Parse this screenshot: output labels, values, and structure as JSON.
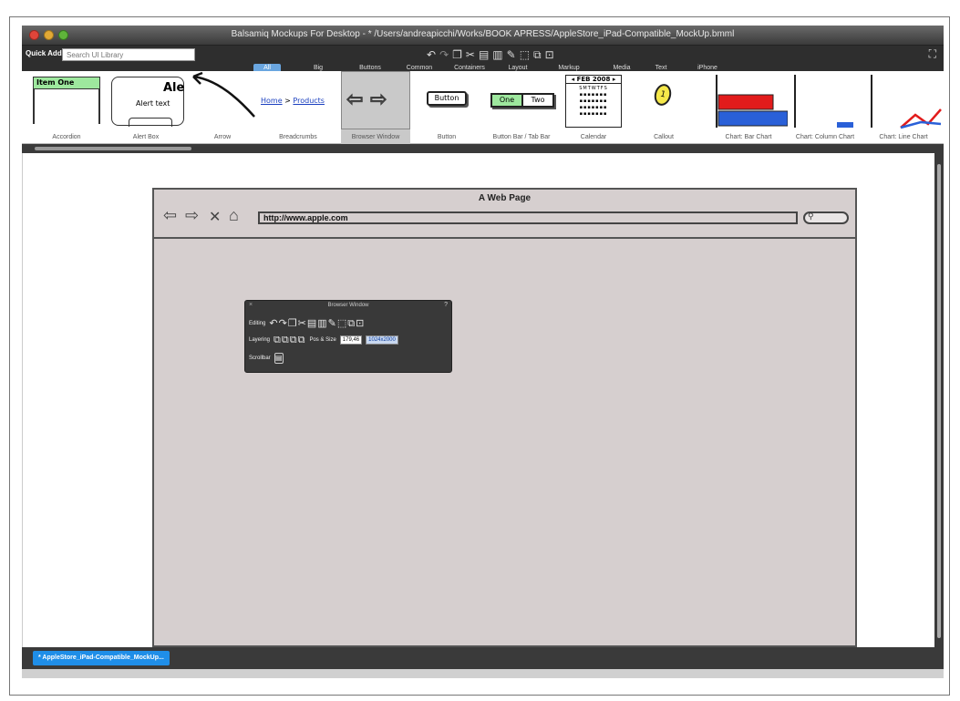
{
  "window": {
    "title": "Balsamiq Mockups For Desktop - * /Users/andreapicchi/Works/BOOK APRESS/AppleStore_iPad-Compatible_MockUp.bmml"
  },
  "toolbar": {
    "quick_add_label": "Quick Add:",
    "search_placeholder": "Search UI Library",
    "edit_icons": [
      "undo-icon",
      "redo-icon",
      "duplicate-icon",
      "cut-icon",
      "copy-icon",
      "paste-icon",
      "edit-icon",
      "group-icon",
      "ungroup-icon",
      "lock-icon"
    ]
  },
  "tabs": [
    {
      "label": "All",
      "active": true
    },
    {
      "label": "Big",
      "active": false
    },
    {
      "label": "Buttons",
      "active": false
    },
    {
      "label": "Common",
      "active": false
    },
    {
      "label": "Containers",
      "active": false
    },
    {
      "label": "Layout",
      "active": false
    },
    {
      "label": "Markup",
      "active": false
    },
    {
      "label": "Media",
      "active": false
    },
    {
      "label": "Text",
      "active": false
    },
    {
      "label": "iPhone",
      "active": false
    }
  ],
  "library": {
    "items": [
      {
        "label": "Accordion",
        "preview": "Item One"
      },
      {
        "label": "Alert Box",
        "preview_title": "Ale",
        "preview_text": "Alert text"
      },
      {
        "label": "Arrow"
      },
      {
        "label": "Breadcrumbs",
        "preview_home": "Home",
        "preview_sep": ">",
        "preview_products": "Products"
      },
      {
        "label": "Browser Window"
      },
      {
        "label": "Button",
        "preview": "Button"
      },
      {
        "label": "Button Bar / Tab Bar",
        "preview_one": "One",
        "preview_two": "Two"
      },
      {
        "label": "Calendar",
        "preview": "FEB 2008"
      },
      {
        "label": "Callout",
        "preview": "1"
      },
      {
        "label": "Chart: Bar Chart"
      },
      {
        "label": "Chart: Column Chart"
      },
      {
        "label": "Chart: Line Chart"
      }
    ]
  },
  "mockup": {
    "browser_title": "A Web Page",
    "url": "http://www.apple.com"
  },
  "inspector": {
    "title": "Browser Window",
    "editing_label": "Editing",
    "layering_label": "Layering",
    "pos_size_label": "Pos & Size",
    "pos_value": "179,46",
    "size_value": "1024x2000",
    "scrollbar_label": "Scrollbar"
  },
  "bottom": {
    "document_tab": "* AppleStore_iPad-Compatible_MockUp..."
  }
}
